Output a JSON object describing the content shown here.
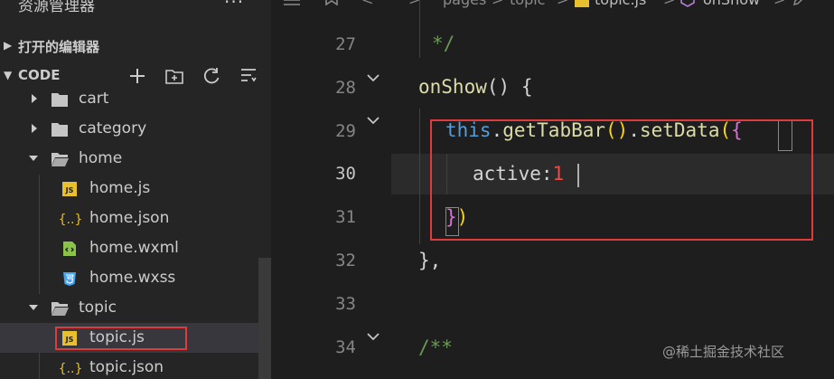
{
  "sidebar": {
    "title": "资源管理器",
    "more_label": "···",
    "open_editors_label": "打开的编辑器",
    "workspace_label": "CODE",
    "tree": [
      {
        "label": "cart",
        "type": "folder",
        "expanded": false
      },
      {
        "label": "category",
        "type": "folder",
        "expanded": false
      },
      {
        "label": "home",
        "type": "folder",
        "expanded": true
      },
      {
        "label": "home.js",
        "type": "js"
      },
      {
        "label": "home.json",
        "type": "json"
      },
      {
        "label": "home.wxml",
        "type": "wxml"
      },
      {
        "label": "home.wxss",
        "type": "wxss"
      },
      {
        "label": "topic",
        "type": "folder",
        "expanded": true
      },
      {
        "label": "topic.js",
        "type": "js",
        "selected": true
      },
      {
        "label": "topic.json",
        "type": "json"
      }
    ],
    "file_icon_text": {
      "js": "JS",
      "json": "{..}"
    }
  },
  "breadcrumbs": {
    "path_pages": "pages",
    "path_topic": "topic",
    "file_name": "topic.js",
    "symbol_name": "onShow",
    "separator": ">"
  },
  "editor": {
    "line_numbers": [
      "27",
      "28",
      "29",
      "30",
      "31",
      "32",
      "33",
      "34"
    ],
    "active_line": "30",
    "code": {
      "l27": "*/",
      "l28_fn": "onShow",
      "l28_parens": "()",
      "l28_brace": "{",
      "l29_this": "this",
      "l29_dot1": ".",
      "l29_fn1": "getTabBar",
      "l29_parens": "()",
      "l29_dot2": ".",
      "l29_fn2": "setData",
      "l29_open_paren": "(",
      "l29_open_brace": "{",
      "l30_prop": "active",
      "l30_colon": ":",
      "l30_val": "1",
      "l31_close_brace": "}",
      "l31_close_paren": ")",
      "l32": "},",
      "l34": "/**"
    }
  },
  "watermark": "@稀土掘金技术社区",
  "colors": {
    "highlight_box": "#e03a3a",
    "sidebar_bg": "#252526",
    "editor_bg": "#1e1e1e"
  }
}
